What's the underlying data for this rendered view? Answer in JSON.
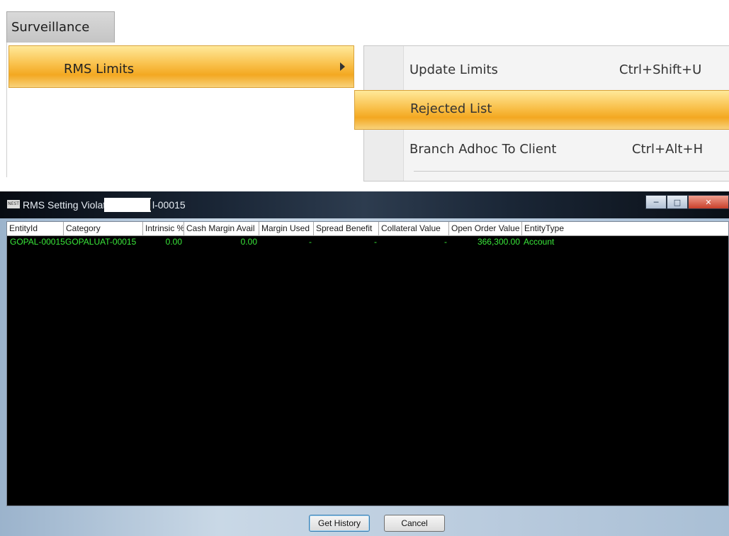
{
  "menu": {
    "tab_label": "Surveillance",
    "item_label": "RMS Limits"
  },
  "submenu": {
    "items": [
      {
        "label": "Update Limits",
        "shortcut": "Ctrl+Shift+U"
      },
      {
        "label": "Rejected List",
        "shortcut": ""
      },
      {
        "label": "Branch Adhoc To Client",
        "shortcut": "Ctrl+Alt+H"
      }
    ]
  },
  "window": {
    "title_prefix": "RMS Setting Violation -",
    "title_suffix": "l-00015",
    "app_icon_text": "NEST"
  },
  "table": {
    "columns": [
      "EntityId",
      "Category",
      "Intrinsic %",
      "Cash Margin Avail",
      "Margin Used",
      "Spread Benefit",
      "Collateral Value",
      "Open Order Value",
      "EntityType"
    ],
    "rows": [
      [
        "GOPAL-00015",
        "GOPALUAT-00015",
        "0.00",
        "0.00",
        "-",
        "-",
        "-",
        "366,300.00",
        "Account"
      ]
    ]
  },
  "buttons": {
    "get_history": "Get History",
    "cancel": "Cancel"
  },
  "colors": {
    "highlight": "#f9c04a",
    "grid_text": "#39e639",
    "grid_background": "#000000"
  }
}
